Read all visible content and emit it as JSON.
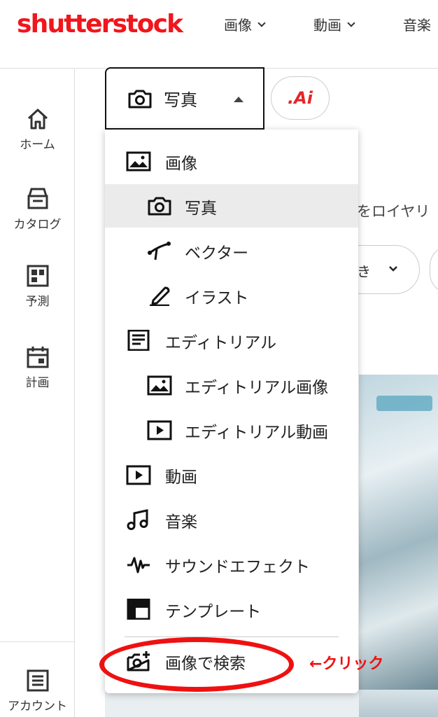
{
  "header": {
    "logo": "shutterstock",
    "nav": [
      {
        "label": "画像"
      },
      {
        "label": "動画"
      },
      {
        "label": "音楽"
      }
    ]
  },
  "sidebar": {
    "items": [
      {
        "label": "ホーム",
        "icon": "home-icon"
      },
      {
        "label": "カタログ",
        "icon": "catalog-icon"
      },
      {
        "label": "予測",
        "icon": "forecast-icon"
      },
      {
        "label": "計画",
        "icon": "calendar-icon"
      }
    ],
    "account": {
      "label": "アカウント",
      "icon": "account-icon"
    }
  },
  "search": {
    "type_selector": {
      "label": "写真",
      "icon": "camera-icon"
    },
    "ai_button": {
      "label": ".Ai"
    }
  },
  "background": {
    "partial_text": "をロイヤリ",
    "filter_pill": "き"
  },
  "dropdown": {
    "items": [
      {
        "label": "画像",
        "icon": "image-icon",
        "level": 0
      },
      {
        "label": "写真",
        "icon": "camera-icon",
        "level": 1,
        "selected": true
      },
      {
        "label": "ベクター",
        "icon": "vector-icon",
        "level": 1
      },
      {
        "label": "イラスト",
        "icon": "pen-icon",
        "level": 1
      },
      {
        "label": "エディトリアル",
        "icon": "editorial-icon",
        "level": 0
      },
      {
        "label": "エディトリアル画像",
        "icon": "image-icon",
        "level": 1
      },
      {
        "label": "エディトリアル動画",
        "icon": "video-icon",
        "level": 1
      },
      {
        "label": "動画",
        "icon": "video-icon",
        "level": 0
      },
      {
        "label": "音楽",
        "icon": "music-icon",
        "level": 0
      },
      {
        "label": "サウンドエフェクト",
        "icon": "waveform-icon",
        "level": 0
      },
      {
        "label": "テンプレート",
        "icon": "template-icon",
        "level": 0
      }
    ],
    "search_by_image": {
      "label": "画像で検索",
      "icon": "camera-plus-icon"
    }
  },
  "annotation": {
    "note": "←クリック",
    "color": "#ee1111"
  },
  "colors": {
    "brand": "#f0161c",
    "selected_bg": "#ebebeb"
  }
}
